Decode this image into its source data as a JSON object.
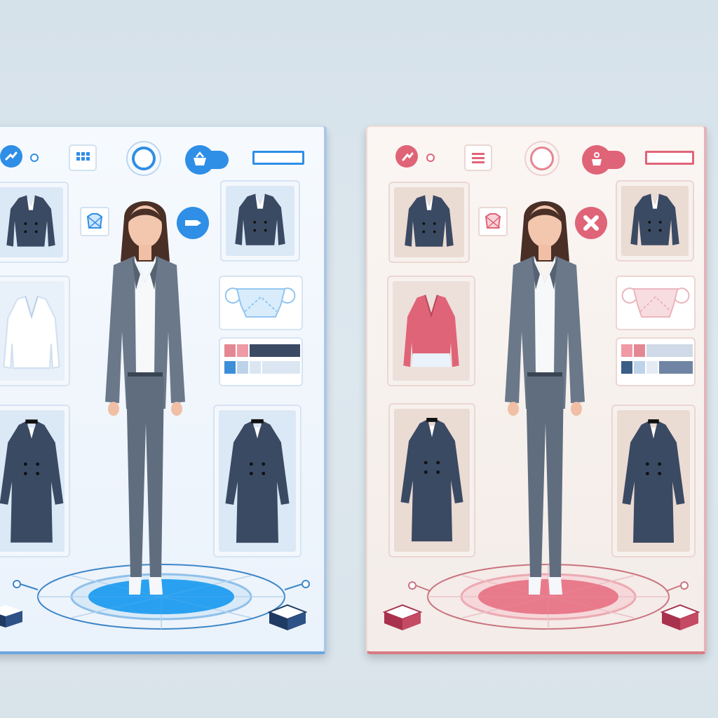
{
  "theme": {
    "blue_accent": "#2f8ee6",
    "blue_platform": "#2aa1f0",
    "pink_accent": "#e06478",
    "pink_platform": "#e87a8b",
    "suit_color": "#6a7889",
    "dark_garment": "#3b4a63"
  },
  "panels": [
    {
      "theme": "blue",
      "toolbar_icons": [
        "share-icon",
        "dot-icon",
        "grid-icon",
        "ring-icon",
        "basket-icon",
        "rectangle-icon"
      ],
      "left_column": [
        "blazer-card",
        "white-blouse-card",
        "dress-coat-card"
      ],
      "right_column": [
        "blazer-card",
        "pattern-card",
        "color-swatch-card",
        "dress-coat-card"
      ],
      "floating_icons": [
        "gem-icon",
        "arrow-icon"
      ],
      "swatches": [
        "#e38893",
        "#3b4a63",
        "#3d8ed9",
        "#bcd3ea",
        "#dbe6f2"
      ]
    },
    {
      "theme": "pink",
      "toolbar_icons": [
        "share-icon",
        "dot-icon",
        "menu-icon",
        "ring-icon",
        "basket-icon",
        "rectangle-icon"
      ],
      "left_column": [
        "blazer-card",
        "pink-blouse-card",
        "dress-coat-card"
      ],
      "right_column": [
        "blazer-card",
        "pattern-card",
        "color-swatch-card",
        "dress-coat-card"
      ],
      "floating_icons": [
        "gem-icon",
        "close-icon"
      ],
      "swatches": [
        "#e38893",
        "#cfd9e7",
        "#3b5e86",
        "#bcd3ea",
        "#6f85a3"
      ]
    }
  ]
}
